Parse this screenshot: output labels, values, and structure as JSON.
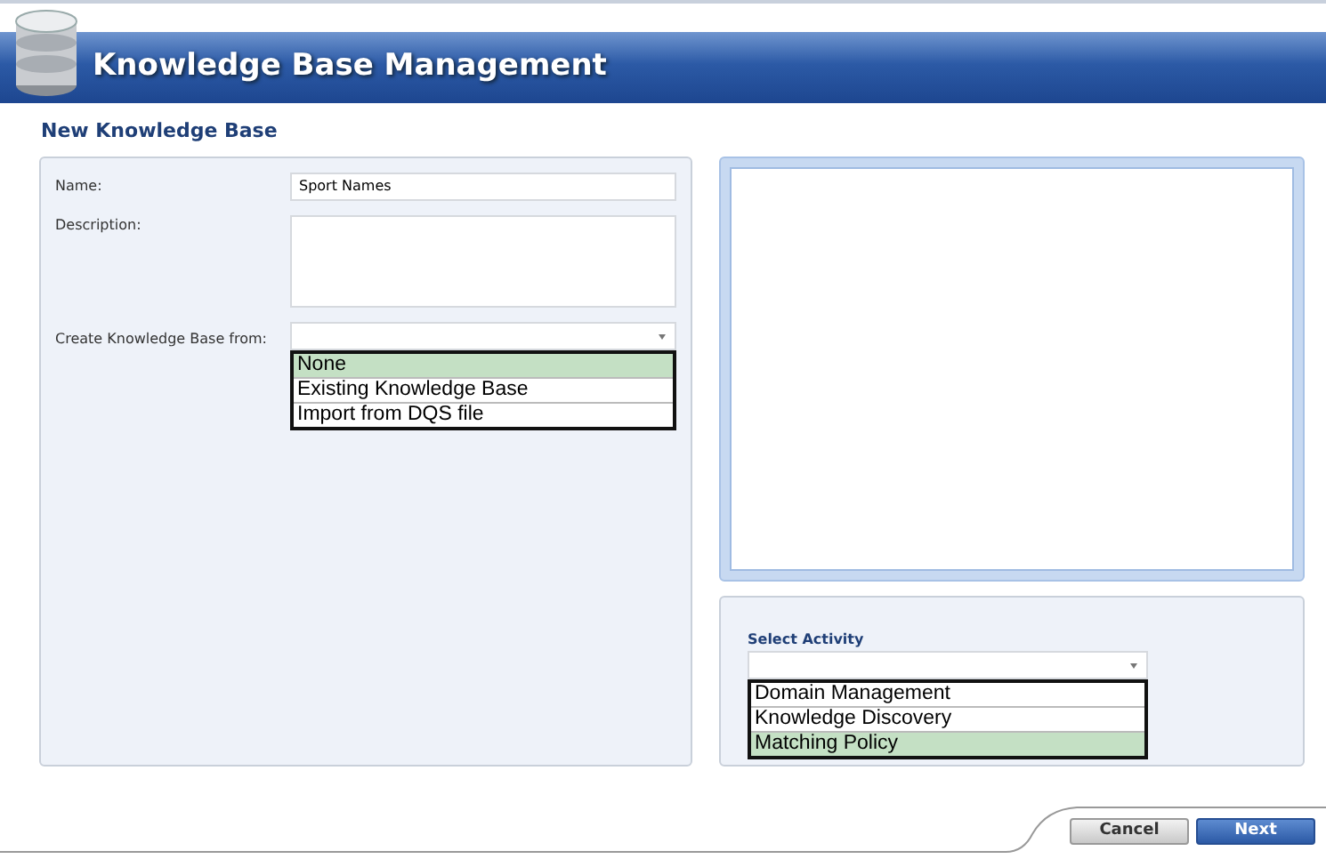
{
  "header": {
    "title": "Knowledge Base Management"
  },
  "section_title": "New Knowledge Base",
  "form": {
    "name": {
      "label": "Name:",
      "value": "Sport Names"
    },
    "description": {
      "label": "Description:"
    },
    "create_from": {
      "label": "Create Knowledge Base from:",
      "options": [
        {
          "label": "None",
          "selected": true
        },
        {
          "label": "Existing Knowledge Base",
          "selected": false
        },
        {
          "label": "Import from DQS file",
          "selected": false
        }
      ]
    }
  },
  "activity": {
    "label": "Select Activity",
    "options": [
      {
        "label": "Domain Management",
        "selected": false
      },
      {
        "label": "Knowledge Discovery",
        "selected": false
      },
      {
        "label": "Matching Policy",
        "selected": true
      }
    ]
  },
  "buttons": [
    {
      "label": "Cancel",
      "kind": "secondary"
    },
    {
      "label": "Next",
      "kind": "primary"
    }
  ]
}
